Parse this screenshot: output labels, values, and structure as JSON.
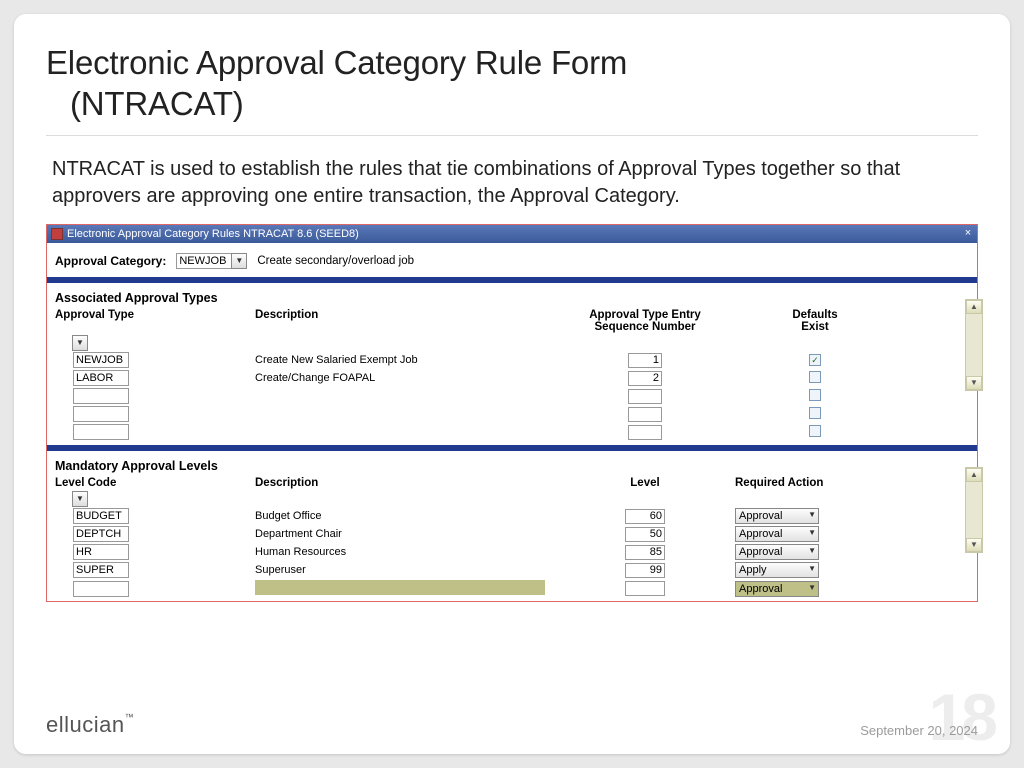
{
  "slide": {
    "title_line1": "Electronic Approval Category Rule Form",
    "title_line2": "(NTRACAT)",
    "body": "NTRACAT is used to establish the rules that tie combinations of Approval Types together so that approvers are approving one entire transaction, the Approval Category."
  },
  "window": {
    "title": "Electronic Approval Category Rules  NTRACAT  8.6  (SEED8)",
    "keyblock": {
      "label": "Approval Category:",
      "code": "NEWJOB",
      "desc": "Create secondary/overload job"
    },
    "assoc": {
      "title": "Associated Approval Types",
      "cols": {
        "type": "Approval Type",
        "desc": "Description",
        "seq_l1": "Approval Type Entry",
        "seq_l2": "Sequence Number",
        "def_l1": "Defaults",
        "def_l2": "Exist"
      },
      "rows": [
        {
          "code": "NEWJOB",
          "desc": "Create New Salaried Exempt Job",
          "seq": "1",
          "check": true
        },
        {
          "code": "LABOR",
          "desc": "Create/Change FOAPAL",
          "seq": "2",
          "check": false
        },
        {
          "code": "",
          "desc": "",
          "seq": "",
          "check": false
        },
        {
          "code": "",
          "desc": "",
          "seq": "",
          "check": false
        },
        {
          "code": "",
          "desc": "",
          "seq": "",
          "check": false
        }
      ]
    },
    "levels": {
      "title": "Mandatory Approval Levels",
      "cols": {
        "code": "Level Code",
        "desc": "Description",
        "level": "Level",
        "action": "Required Action"
      },
      "rows": [
        {
          "code": "BUDGET",
          "desc": "Budget Office",
          "level": "60",
          "action": "Approval"
        },
        {
          "code": "DEPTCH",
          "desc": "Department Chair",
          "level": "50",
          "action": "Approval"
        },
        {
          "code": "HR",
          "desc": "Human Resources",
          "level": "85",
          "action": "Approval"
        },
        {
          "code": "SUPER",
          "desc": "Superuser",
          "level": "99",
          "action": "Apply"
        }
      ],
      "new_action": "Approval"
    }
  },
  "footer": {
    "brand": "ellucian",
    "date": "September 20, 2024",
    "page": "18"
  }
}
